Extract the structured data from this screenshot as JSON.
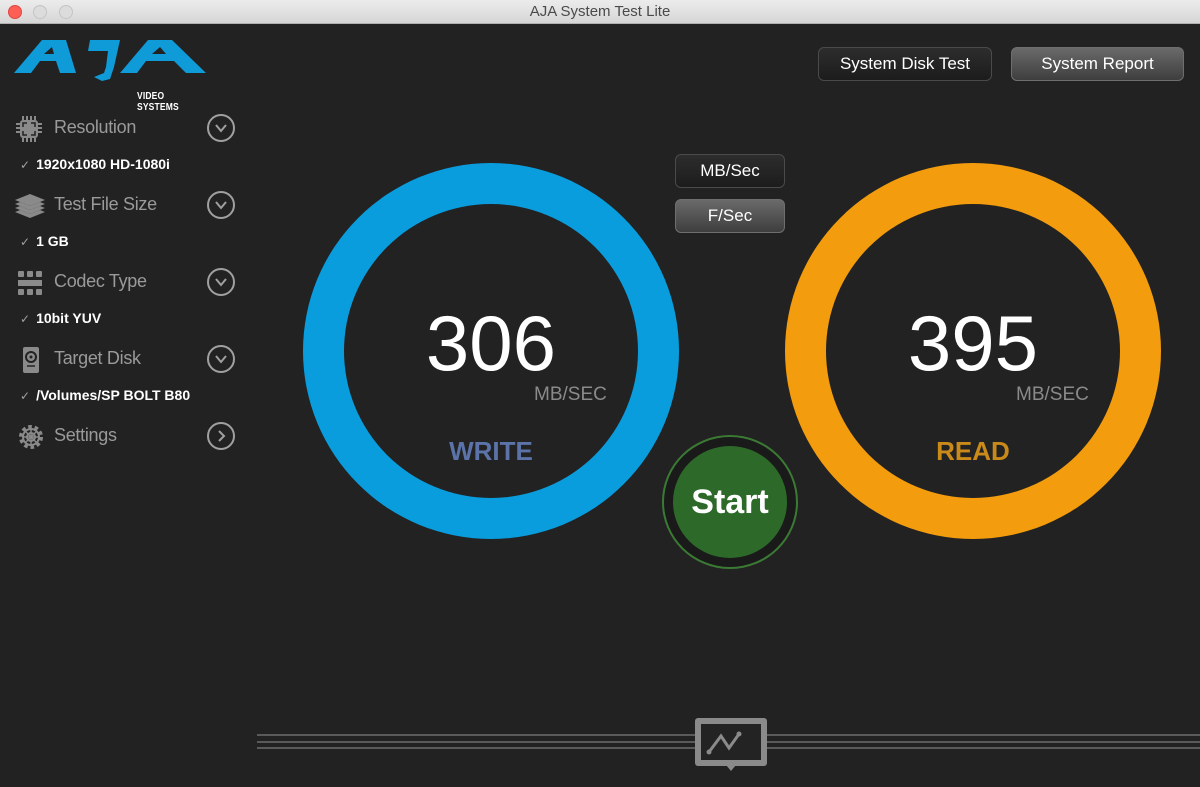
{
  "window": {
    "title": "AJA System Test Lite"
  },
  "logo": {
    "brand": "AJA",
    "subtitle": "VIDEO SYSTEMS",
    "color": "#0f9ad8"
  },
  "sidebar": {
    "items": [
      {
        "label": "Resolution",
        "icon": "chip-icon",
        "expander": "chevron-down-icon",
        "value": "1920x1080 HD-1080i"
      },
      {
        "label": "Test File Size",
        "icon": "stack-icon",
        "expander": "chevron-down-icon",
        "value": "1 GB"
      },
      {
        "label": "Codec Type",
        "icon": "film-strip-icon",
        "expander": "chevron-down-icon",
        "value": "10bit YUV"
      },
      {
        "label": "Target Disk",
        "icon": "hard-disk-icon",
        "expander": "chevron-down-icon",
        "value": "/Volumes/SP BOLT B80"
      },
      {
        "label": "Settings",
        "icon": "gear-icon",
        "expander": "chevron-right-icon"
      }
    ],
    "check_glyph": "✓"
  },
  "toolbar": {
    "system_disk_test": "System Disk Test",
    "system_report": "System Report"
  },
  "units_toggle": {
    "mb_sec": "MB/Sec",
    "f_sec": "F/Sec"
  },
  "write": {
    "value": "306",
    "unit": "MB/SEC",
    "label": "WRITE",
    "ring_color": "#0a9dde",
    "label_color": "#5b73a8"
  },
  "read": {
    "value": "395",
    "unit": "MB/SEC",
    "label": "READ",
    "ring_color": "#f39c0e",
    "label_color": "#c98a1a"
  },
  "start_button": {
    "label": "Start",
    "color": "#2d6a2a"
  },
  "bottom": {
    "graph_icon": "line-graph-icon"
  }
}
